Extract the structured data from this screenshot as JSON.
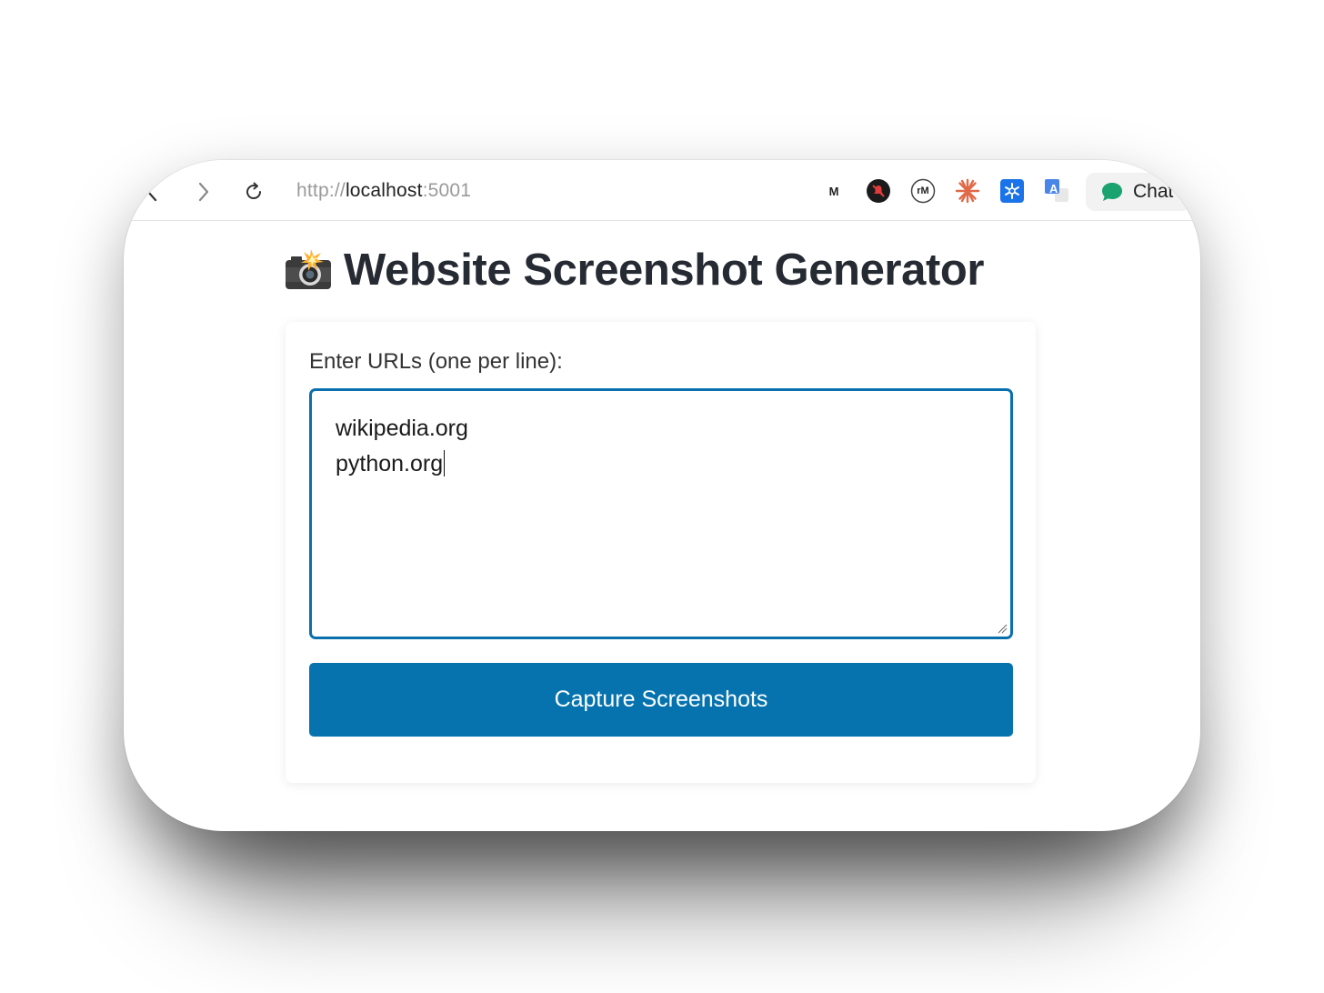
{
  "browser": {
    "url_scheme": "http://",
    "url_host": "localhost",
    "url_port": ":5001",
    "back_icon": "chevron-left-icon",
    "forward_icon": "chevron-right-icon",
    "reload_icon": "reload-icon",
    "extensions": [
      {
        "name": "m-extension",
        "text": "M"
      },
      {
        "name": "bell-off-extension",
        "text": ""
      },
      {
        "name": "rm-extension",
        "text": "rM"
      },
      {
        "name": "claude-starburst-extension",
        "text": ""
      },
      {
        "name": "snowflake-extension",
        "text": ""
      },
      {
        "name": "translate-extension",
        "text": "A"
      }
    ],
    "chat_button_label": "Chat"
  },
  "page": {
    "title_emoji": "📸",
    "title": "Website Screenshot Generator",
    "form": {
      "urls_label": "Enter URLs (one per line):",
      "urls_lines": [
        "wikipedia.org",
        "python.org"
      ],
      "submit_label": "Capture Screenshots"
    }
  },
  "colors": {
    "primary": "#0673af",
    "textarea_border": "#0a6fad",
    "title_text": "#262a33",
    "chat_icon": "#1aa36f",
    "starburst": "#e06a48",
    "snowflake": "#1a73e8"
  }
}
